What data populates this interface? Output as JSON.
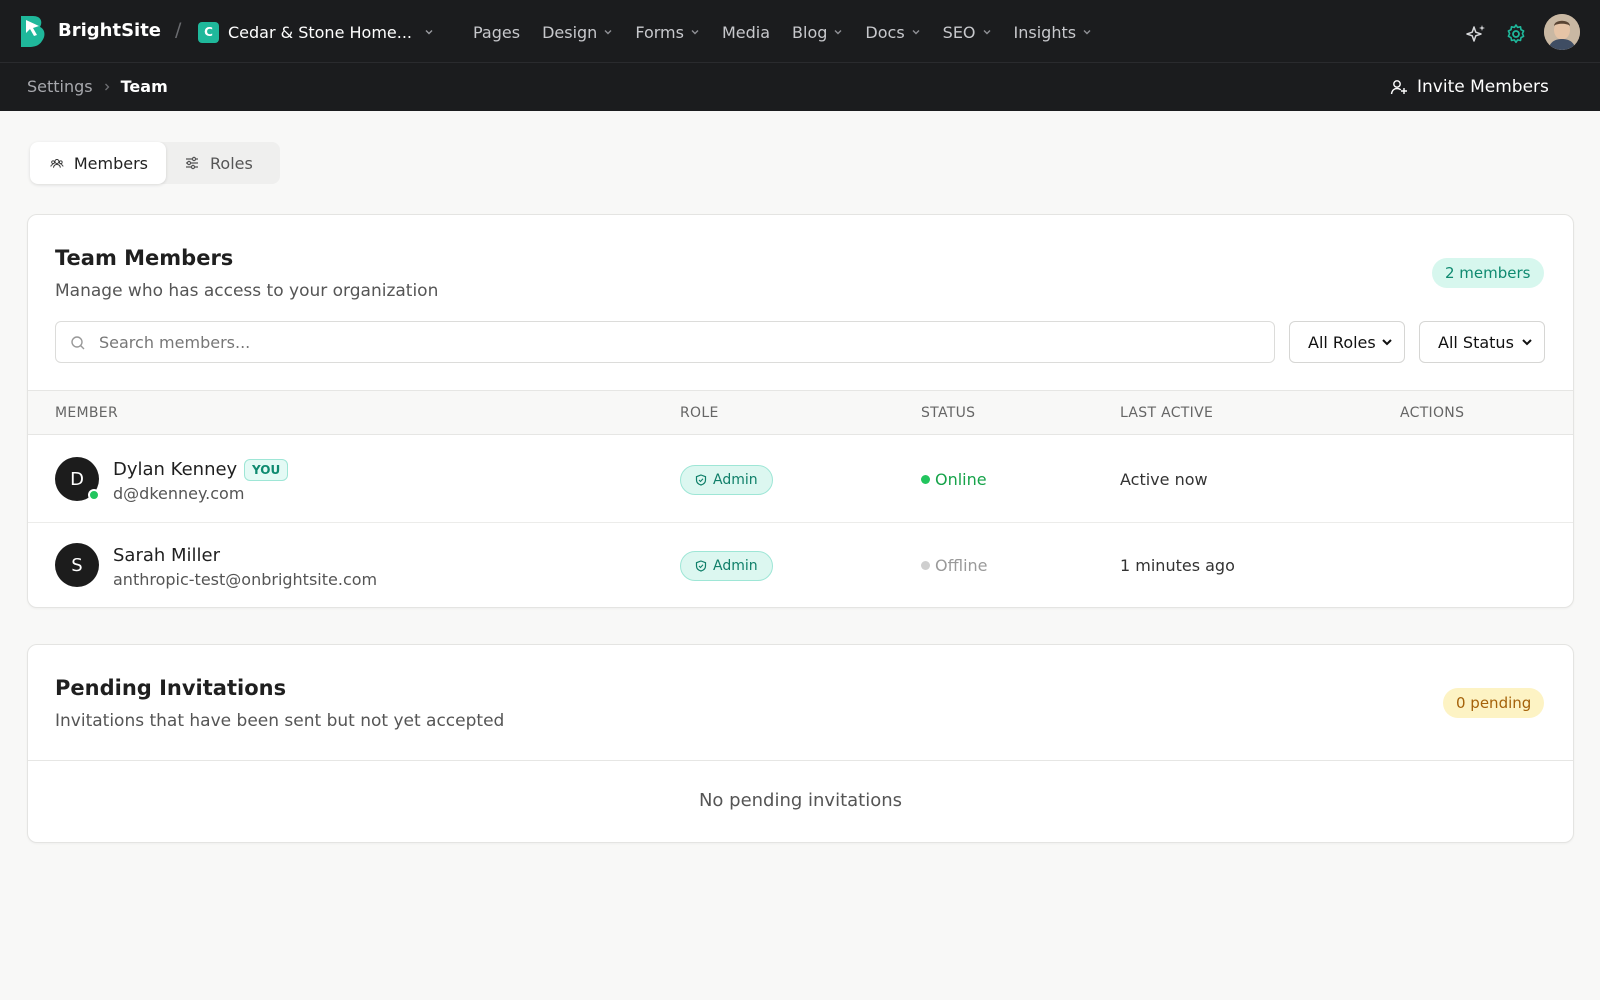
{
  "app": {
    "brand": "BrightSite",
    "site_initial": "C",
    "site_name": "Cedar & Stone Home...",
    "accent": "#1fb89b"
  },
  "nav": [
    {
      "label": "Pages",
      "dropdown": false
    },
    {
      "label": "Design",
      "dropdown": true
    },
    {
      "label": "Forms",
      "dropdown": true
    },
    {
      "label": "Media",
      "dropdown": false
    },
    {
      "label": "Blog",
      "dropdown": true
    },
    {
      "label": "Docs",
      "dropdown": true
    },
    {
      "label": "SEO",
      "dropdown": true
    },
    {
      "label": "Insights",
      "dropdown": true
    }
  ],
  "breadcrumb": {
    "parent": "Settings",
    "current": "Team"
  },
  "invite_label": "Invite Members",
  "tabs": [
    {
      "label": "Members",
      "active": true
    },
    {
      "label": "Roles",
      "active": false
    }
  ],
  "team": {
    "title": "Team Members",
    "subtitle": "Manage who has access to your organization",
    "count_badge": "2 members",
    "search_placeholder": "Search members...",
    "role_filter": "All Roles",
    "status_filter": "All Status",
    "columns": [
      "MEMBER",
      "ROLE",
      "STATUS",
      "LAST ACTIVE",
      "ACTIONS"
    ],
    "members": [
      {
        "initial": "D",
        "name": "Dylan Kenney",
        "you_label": "YOU",
        "email": "d@dkenney.com",
        "role": "Admin",
        "status": "Online",
        "status_color": "#16a34a",
        "last_active": "Active now"
      },
      {
        "initial": "S",
        "name": "Sarah Miller",
        "email": "anthropic-test@onbrightsite.com",
        "role": "Admin",
        "status": "Offline",
        "status_color": "#9a9a9a",
        "last_active": "1 minutes ago"
      }
    ]
  },
  "pending": {
    "title": "Pending Invitations",
    "subtitle": "Invitations that have been sent but not yet accepted",
    "count_badge": "0 pending",
    "empty_text": "No pending invitations"
  }
}
